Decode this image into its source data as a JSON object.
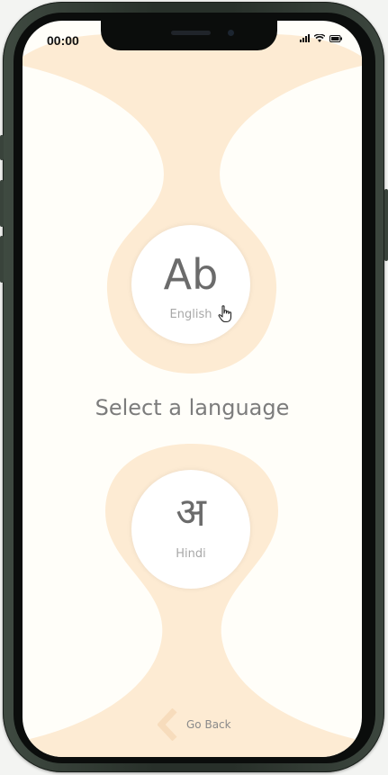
{
  "status_bar": {
    "time": "00:00",
    "icons": [
      "signal-icon",
      "wifi-icon",
      "battery-icon"
    ]
  },
  "languages": [
    {
      "glyph": "Ab",
      "name": "English"
    },
    {
      "glyph": "अ",
      "name": "Hindi"
    }
  ],
  "title": "Select a language",
  "go_back_label": "Go Back",
  "colors": {
    "accent_shape": "#fdebd3",
    "screen_bg": "#fffef9",
    "text": "#7c7c7c",
    "frame": "#28302a"
  }
}
